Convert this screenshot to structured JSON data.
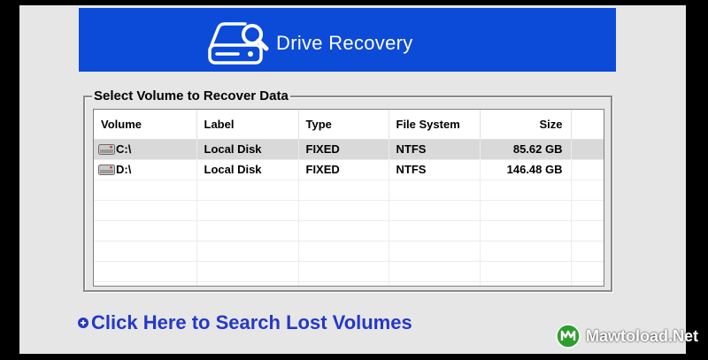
{
  "header": {
    "title": "Drive Recovery",
    "icon": "drive-search-icon",
    "color": "#0c4ad8"
  },
  "group": {
    "legend": "Select Volume to Recover Data"
  },
  "table": {
    "columns": [
      "Volume",
      "Label",
      "Type",
      "File System",
      "Size"
    ],
    "rows": [
      {
        "volume": "C:\\",
        "label": "Local Disk",
        "type": "FIXED",
        "fs": "NTFS",
        "size": "85.62 GB",
        "selected": true
      },
      {
        "volume": "D:\\",
        "label": "Local Disk",
        "type": "FIXED",
        "fs": "NTFS",
        "size": "146.48 GB",
        "selected": false
      }
    ]
  },
  "search_link": {
    "label": "Click Here to Search Lost Volumes",
    "color": "#2438c8"
  },
  "watermark": {
    "text": "Mawtoload.Net"
  }
}
